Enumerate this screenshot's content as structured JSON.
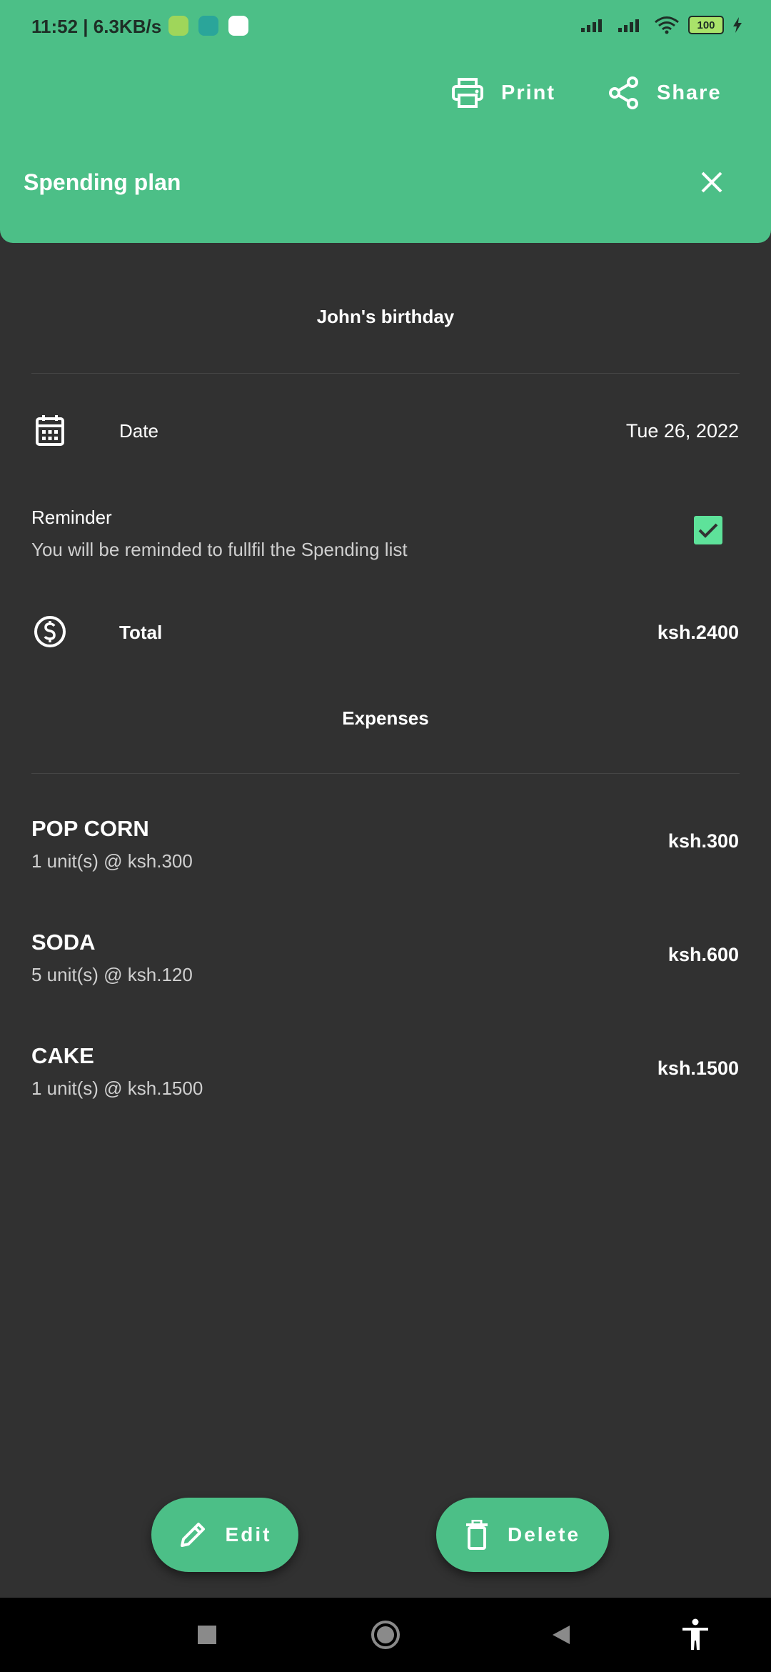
{
  "status_bar": {
    "time": "11:52 | 6.3KB/s",
    "battery": "100"
  },
  "toolbar": {
    "print_label": "Print",
    "share_label": "Share"
  },
  "page_title": "Spending plan",
  "event_title": "John's birthday",
  "date_row": {
    "label": "Date",
    "value": "Tue 26, 2022"
  },
  "reminder": {
    "title": "Reminder",
    "subtitle": "You will be reminded to fullfil the Spending list",
    "checked": true
  },
  "total_row": {
    "label": "Total",
    "value": "ksh.2400"
  },
  "expenses_title": "Expenses",
  "expenses": [
    {
      "name": "POP CORN",
      "detail": "1 unit(s) @ ksh.300",
      "amount": "ksh.300"
    },
    {
      "name": "SODA",
      "detail": "5 unit(s) @ ksh.120",
      "amount": "ksh.600"
    },
    {
      "name": "CAKE",
      "detail": "1 unit(s) @ ksh.1500",
      "amount": "ksh.1500"
    }
  ],
  "actions": {
    "edit_label": "Edit",
    "delete_label": "Delete"
  },
  "colors": {
    "accent": "#4cbf87",
    "background": "#313131",
    "checkbox": "#5ee29a"
  }
}
